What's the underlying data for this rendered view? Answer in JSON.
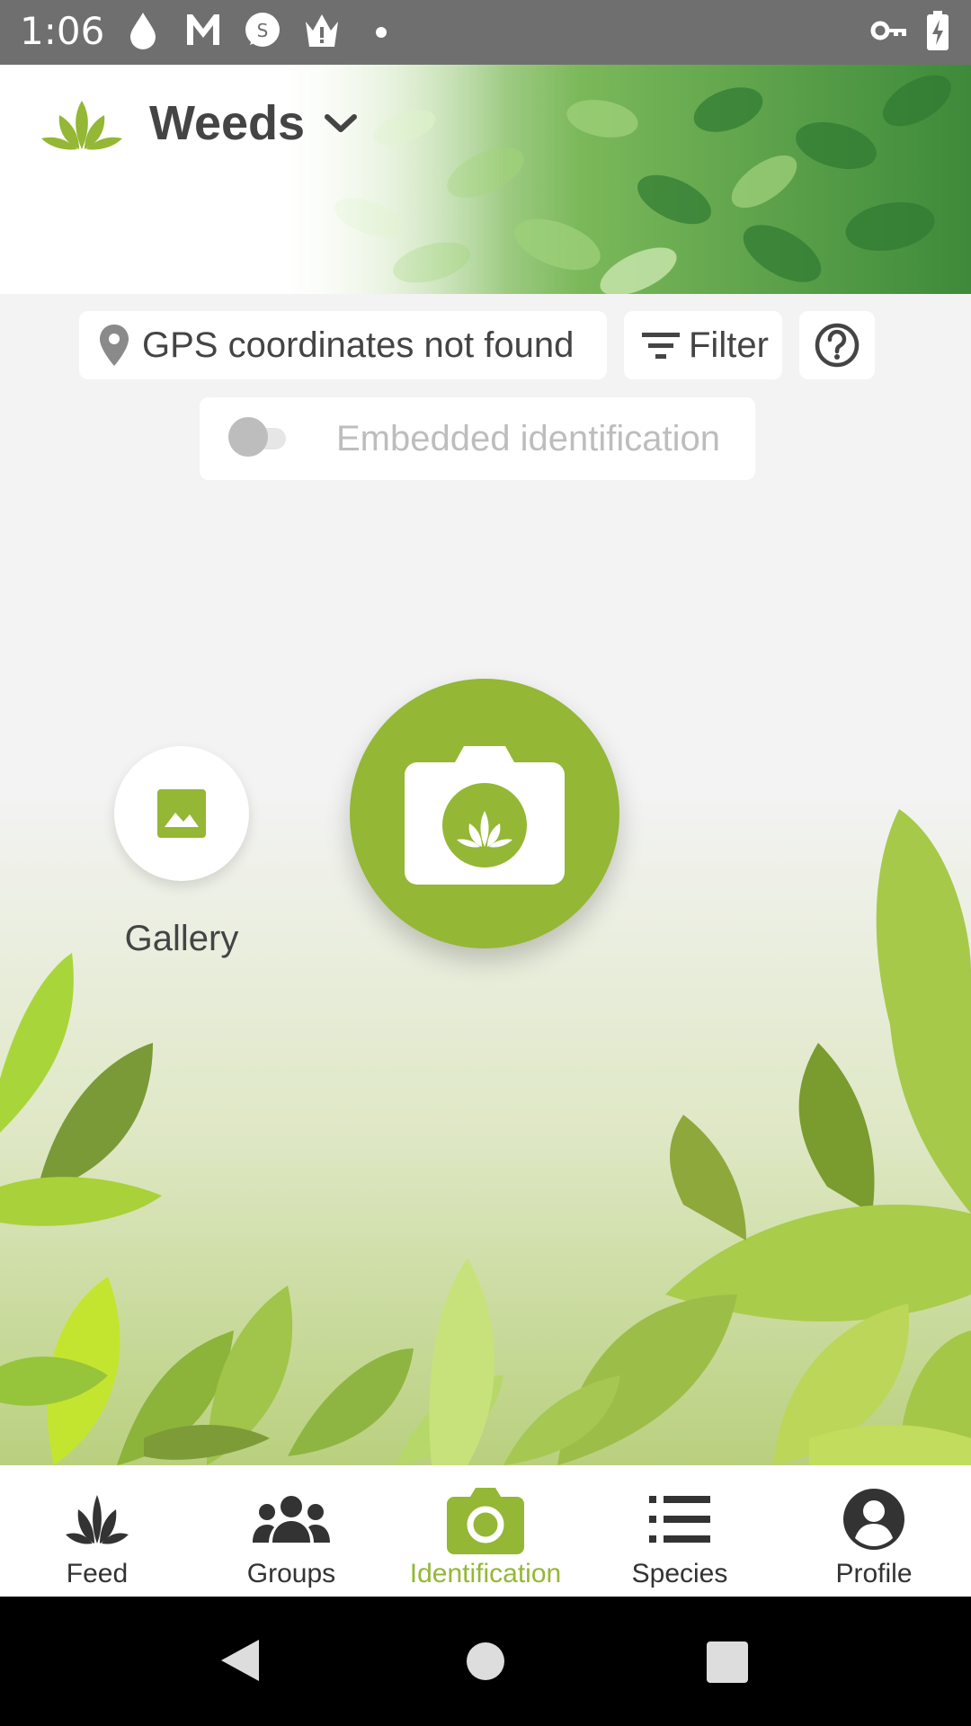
{
  "status_bar": {
    "time": "1:06",
    "icons": [
      "drop-icon",
      "gmail-icon",
      "messenger-icon",
      "crown-alert-icon",
      "dot-icon",
      "vpn-key-icon",
      "battery-charging-icon"
    ]
  },
  "header": {
    "title": "Weeds",
    "icons": [
      "plant-logo-icon",
      "chevron-down-icon"
    ]
  },
  "chips": {
    "gps_text": "GPS coordinates not found",
    "filter_text": "Filter",
    "help_icon": "help-circle-icon"
  },
  "embedded": {
    "label": "Embedded identification",
    "enabled": false
  },
  "actions": {
    "gallery_label": "Gallery",
    "camera_icon": "camera-plant-icon",
    "gallery_icon": "image-icon"
  },
  "bottom_nav": {
    "items": [
      {
        "label": "Feed",
        "icon": "plant-sprout-icon",
        "active": false
      },
      {
        "label": "Groups",
        "icon": "groups-icon",
        "active": false
      },
      {
        "label": "Identification",
        "icon": "camera-icon",
        "active": true
      },
      {
        "label": "Species",
        "icon": "list-icon",
        "active": false
      },
      {
        "label": "Profile",
        "icon": "account-circle-icon",
        "active": false
      }
    ]
  },
  "colors": {
    "accent": "#94b735",
    "status_bar": "#6f6f6f",
    "background": "#f3f3f3",
    "text": "#444444",
    "system_nav": "#000000"
  },
  "system_nav": [
    "back-icon",
    "home-icon",
    "recents-icon"
  ]
}
